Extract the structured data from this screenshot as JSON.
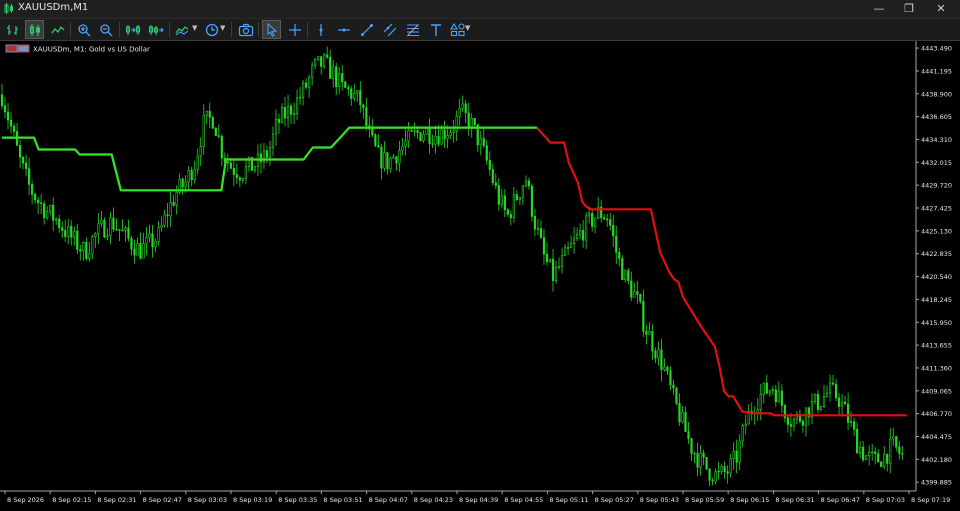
{
  "window": {
    "title": "XAUUSDm,M1",
    "minimize_glyph": "—",
    "restore_glyph": "❐",
    "close_glyph": "✕"
  },
  "toolbar": {
    "buttons": [
      {
        "name": "bar-chart-icon"
      },
      {
        "name": "candlestick-chart-icon",
        "active": true
      },
      {
        "name": "line-chart-icon"
      },
      {
        "name": "zoom-in-icon"
      },
      {
        "name": "zoom-out-icon"
      },
      {
        "name": "tile-windows-icon"
      },
      {
        "name": "autoscroll-icon"
      },
      {
        "name": "indicators-icon",
        "dropdown": true
      },
      {
        "name": "period-clock-icon",
        "dropdown": true
      },
      {
        "name": "screenshot-icon"
      },
      {
        "name": "cursor-icon",
        "active": true
      },
      {
        "name": "crosshair-icon"
      },
      {
        "name": "vertical-line-icon"
      },
      {
        "name": "horizontal-line-icon"
      },
      {
        "name": "trend-line-icon"
      },
      {
        "name": "channel-icon"
      },
      {
        "name": "fibonacci-icon"
      },
      {
        "name": "text-tool-icon"
      },
      {
        "name": "shapes-icon",
        "dropdown": true
      }
    ]
  },
  "chart": {
    "legend_text": "XAUUSDm, M1:  Gold vs US Dollar",
    "colors": {
      "background": "#000000",
      "candles": "#26d926",
      "line_up": "#28e628",
      "line_down": "#e01010",
      "axis": "#a6a6a6",
      "text": "#e8e8e8"
    }
  },
  "chart_data": {
    "type": "line",
    "symbol": "XAUUSDm",
    "timeframe": "M1",
    "y_ticks": [
      "4443.490",
      "4441.195",
      "4438.900",
      "4436.605",
      "4434.310",
      "4432.015",
      "4429.720",
      "4427.425",
      "4425.130",
      "4422.835",
      "4420.540",
      "4418.245",
      "4415.950",
      "4413.655",
      "4411.360",
      "4409.065",
      "4406.770",
      "4404.475",
      "4402.180",
      "4399.885"
    ],
    "x_ticks": [
      "8 Sep 2026",
      "8 Sep 02:15",
      "8 Sep 02:31",
      "8 Sep 02:47",
      "8 Sep 03:03",
      "8 Sep 03:19",
      "8 Sep 03:35",
      "8 Sep 03:51",
      "8 Sep 04:07",
      "8 Sep 04:23",
      "8 Sep 04:39",
      "8 Sep 04:55",
      "8 Sep 05:11",
      "8 Sep 05:27",
      "8 Sep 05:43",
      "8 Sep 05:59",
      "8 Sep 06:15",
      "8 Sep 06:31",
      "8 Sep 06:47",
      "8 Sep 07:03",
      "8 Sep 07:19"
    ],
    "ylim": [
      4399.0,
      4444.0
    ],
    "price_path": [
      4438.8,
      4435.5,
      4432.0,
      4429.5,
      4428.0,
      4427.0,
      4426.2,
      4425.0,
      4424.0,
      4423.0,
      4424.5,
      4425.5,
      4426.0,
      4425.0,
      4424.0,
      4423.2,
      4423.8,
      4424.5,
      4427.0,
      4429.0,
      4430.0,
      4432.0,
      4436.0,
      4436.5,
      4433.0,
      4431.5,
      4431.0,
      4431.5,
      4432.0,
      4433.0,
      4436.0,
      4437.0,
      4438.0,
      4439.5,
      4441.5,
      4442.0,
      4441.0,
      4439.5,
      4439.0,
      4438.0,
      4434.5,
      4432.5,
      4432.0,
      4433.0,
      4434.0,
      4434.8,
      4435.2,
      4434.8,
      4435.0,
      4435.5,
      4437.0,
      4436.0,
      4434.0,
      4431.5,
      4428.5,
      4426.5,
      4428.5,
      4430.5,
      4426.0,
      4422.5,
      4420.5,
      4422.0,
      4423.5,
      4425.0,
      4426.0,
      4427.0,
      4426.5,
      4422.5,
      4420.0,
      4418.5,
      4415.5,
      4413.5,
      4411.5,
      4408.5,
      4406.0,
      4403.5,
      4402.0,
      4401.0,
      4400.5,
      4401.0,
      4402.5,
      4406.0,
      4408.0,
      4409.0,
      4409.5,
      4407.5,
      4406.0,
      4406.5,
      4407.5,
      4408.0,
      4409.0,
      4408.5,
      4406.5,
      4404.0,
      4402.5,
      4402.0,
      4402.5,
      4403.5,
      4402.5
    ],
    "series": [
      {
        "trend": "up",
        "x": [
          0,
          0.035,
          0.04,
          0.08,
          0.085,
          0.12,
          0.13,
          0.24,
          0.245,
          0.33,
          0.34,
          0.36,
          0.37,
          0.38,
          0.39,
          0.585
        ],
        "y": [
          4434.5,
          4434.5,
          4433.3,
          4433.3,
          4432.8,
          4432.8,
          4429.2,
          4429.2,
          4432.3,
          4432.3,
          4433.5,
          4433.5,
          4434.5,
          4435.5,
          4435.5,
          4435.5
        ]
      },
      {
        "trend": "down",
        "x": [
          0,
          0.035,
          0.04,
          0.08,
          0.085,
          0.12,
          0.13,
          0.24,
          0.245,
          0.33,
          0.34,
          0.36,
          0.37,
          0.38,
          0.39,
          0.585,
          0.6,
          0.615,
          0.62,
          0.63,
          0.635,
          0.64,
          0.645,
          0.71,
          0.72,
          0.73,
          0.735,
          0.74,
          0.745,
          0.765,
          0.78,
          0.785,
          0.79,
          0.795,
          0.8,
          0.81,
          0.82,
          0.84,
          0.845,
          0.99
        ],
        "y": [
          4434.5,
          4434.5,
          4433.3,
          4433.3,
          4432.8,
          4432.8,
          4429.2,
          4429.2,
          4432.3,
          4432.3,
          4433.5,
          4433.5,
          4434.5,
          4435.5,
          4435.5,
          4435.5,
          4434.0,
          4434.0,
          4432.0,
          4430.0,
          4428.0,
          4427.5,
          4427.3,
          4427.3,
          4423.0,
          4421.0,
          4420.3,
          4420.0,
          4418.5,
          4415.5,
          4413.5,
          4411.5,
          4409.0,
          4408.5,
          4408.5,
          4407.0,
          4406.8,
          4406.8,
          4406.6,
          4406.6
        ]
      }
    ]
  }
}
